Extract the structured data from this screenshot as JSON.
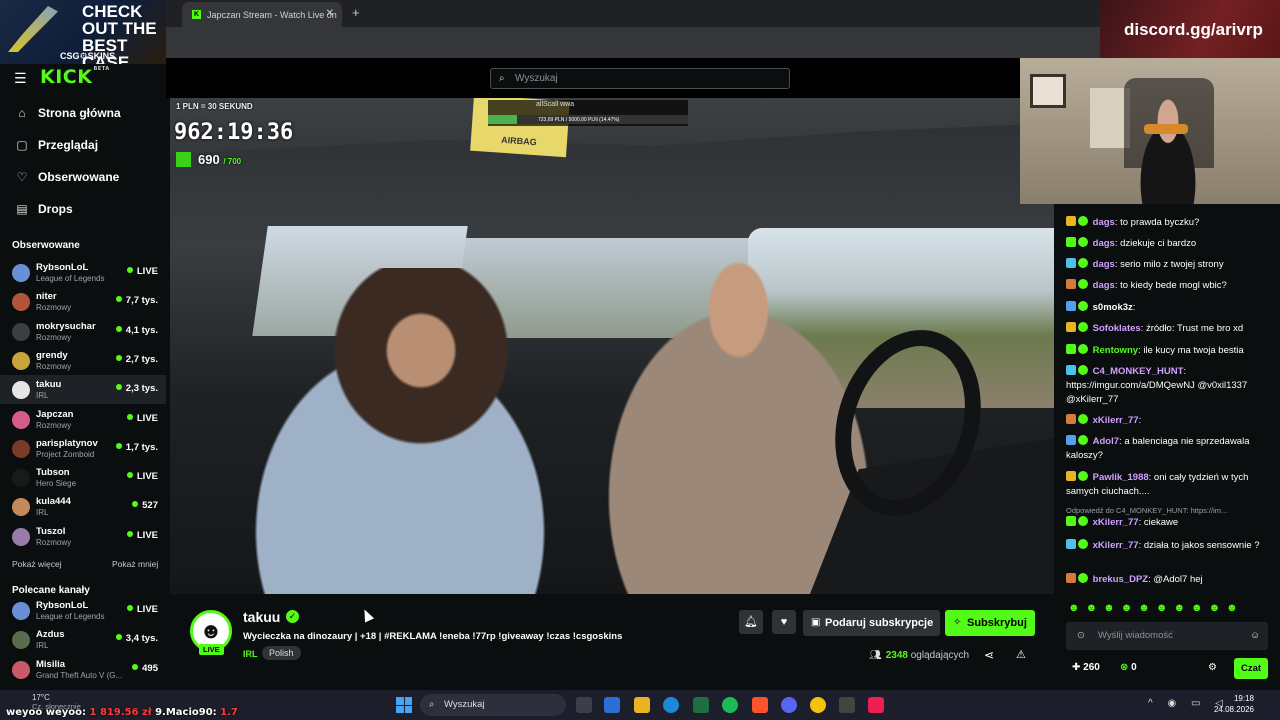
{
  "browser": {
    "tab_title": "Japczan Stream - Watch Live on",
    "new_tab": "+",
    "close": "✕"
  },
  "promo": {
    "headline": "CHECK OUT THE BEST CASE",
    "brand": "CSG⚙SKINS"
  },
  "discord_banner": "discord.gg/arivrp",
  "sidebar": {
    "logo": "KICK",
    "beta": "BETA",
    "nav": [
      {
        "label": "Strona główna",
        "icon": "home-icon"
      },
      {
        "label": "Przeglądaj",
        "icon": "browse-icon"
      },
      {
        "label": "Obserwowane",
        "icon": "heart-icon"
      },
      {
        "label": "Drops",
        "icon": "drops-icon"
      }
    ],
    "followed_title": "Obserwowane",
    "followed": [
      {
        "name": "RybsonLoL",
        "category": "League of Legends",
        "viewers": "LIVE",
        "color": "#6b8fd6"
      },
      {
        "name": "niter",
        "category": "Rozmowy",
        "viewers": "7,7 tys.",
        "color": "#b0553c"
      },
      {
        "name": "mokrysuchar",
        "category": "Rozmowy",
        "viewers": "4,1 tys.",
        "color": "#3a3f46"
      },
      {
        "name": "grendy",
        "category": "Rozmowy",
        "viewers": "2,7 tys.",
        "color": "#c9a43a"
      },
      {
        "name": "takuu",
        "category": "IRL",
        "viewers": "2,3 tys.",
        "color": "#e6e6e6"
      },
      {
        "name": "Japczan",
        "category": "Rozmowy",
        "viewers": "LIVE",
        "color": "#d65a8a"
      },
      {
        "name": "parisplatynov",
        "category": "Project Zomboid",
        "viewers": "1,7 tys.",
        "color": "#7a3a2a"
      },
      {
        "name": "Tubson",
        "category": "Hero Siege",
        "viewers": "LIVE",
        "color": "#1a1a1a"
      },
      {
        "name": "kula444",
        "category": "IRL",
        "viewers": "527",
        "color": "#c28a5a"
      },
      {
        "name": "Tuszol",
        "category": "Rozmowy",
        "viewers": "LIVE",
        "color": "#9a7aa8"
      }
    ],
    "show_more": "Pokaż więcej",
    "show_less": "Pokaż mniej",
    "recommended_title": "Polecane kanały",
    "recommended": [
      {
        "name": "RybsonLoL",
        "category": "League of Legends",
        "viewers": "LIVE",
        "color": "#6b8fd6"
      },
      {
        "name": "Azdus",
        "category": "IRL",
        "viewers": "3,4 tys.",
        "color": "#5a6a4a"
      },
      {
        "name": "Misilia",
        "category": "Grand Theft Auto V (G...",
        "viewers": "495",
        "color": "#c85a6a"
      }
    ]
  },
  "search": {
    "placeholder": "Wyszukaj"
  },
  "video_overlay": {
    "rate": "1 PLN = 30 SEKUND",
    "timer": "962:19:36",
    "count": "690",
    "count_goal": "/ 700",
    "goal_name": "allScall wwa",
    "goal_bar": "723,69 PLN / 5000,00 PLN (14.47%)",
    "goal_fraction": 0.1447,
    "airbag": "AIRBAG"
  },
  "stream": {
    "name": "takuu",
    "live": "LIVE",
    "title": "Wycieczka na dinozaury | +18 | #REKLAMA !eneba !77rp !giveaway !czas !csgoskins",
    "category": "IRL",
    "tag": "Polish",
    "gift_label": "Podaruj subskrypcje",
    "subscribe_label": "Subskrybuj",
    "viewers": "2348",
    "viewers_suffix": "oglądających"
  },
  "chat": {
    "messages": [
      {
        "user": "dags",
        "text": "to prawda byczku?",
        "color": "#d0a0ff"
      },
      {
        "user": "dags",
        "text": "dziekuje ci bardzo",
        "color": "#d0a0ff"
      },
      {
        "user": "dags",
        "text": "serio milo z twojej strony",
        "color": "#d0a0ff"
      },
      {
        "user": "dags",
        "text": "to kiedy bede mogl wbic?",
        "color": "#d0a0ff"
      },
      {
        "user": "s0mok3z",
        "text": "",
        "color": "#ffffff"
      },
      {
        "user": "Sofoklates",
        "text": "źródło: Trust me bro xd",
        "color": "#d0a0ff"
      },
      {
        "user": "Rentowny",
        "text": "ile kucy ma twoja bestia",
        "color": "#53fc18"
      },
      {
        "user": "C4_MONKEY_HUNT",
        "text": "https://imgur.com/a/DMQewNJ @v0xil1337 @xKilerr_77",
        "color": "#d0a0ff"
      },
      {
        "user": "xKilerr_77",
        "text": "",
        "color": "#d0a0ff"
      },
      {
        "user": "Adol7",
        "text": "a balenciaga nie sprzedawala kaloszy?",
        "color": "#d0a0ff"
      },
      {
        "user": "Pawlik_1988",
        "text": "oni cały tydzień w tych samych ciuchach....",
        "color": "#d0a0ff"
      },
      {
        "user": "xKilerr_77",
        "text": "ciekawe",
        "color": "#d0a0ff"
      },
      {
        "user": "xKilerr_77",
        "text": "działa to jakos sensownie ?",
        "color": "#d0a0ff"
      },
      {
        "user": "brekus_DPZ",
        "text": "@Adol7 hej",
        "color": "#d0a0ff"
      }
    ],
    "reply_context": "Odpowiedź do C4_MONKEY_HUNT: https://im...",
    "input_placeholder": "Wyślij wiadomość",
    "points": "260",
    "kicks": "0",
    "send_label": "Czat"
  },
  "taskbar": {
    "weather_temp": "17°C",
    "weather_desc": "Cz. słonecznie",
    "search": "Wyszukaj",
    "time": "19:18",
    "date": "24.08.2026",
    "ticker_prefix": "weyoo weyoo:",
    "ticker_amount": "1 819.56 zł",
    "ticker_mid": "9.Macio90:",
    "ticker_tail": "1.7"
  }
}
